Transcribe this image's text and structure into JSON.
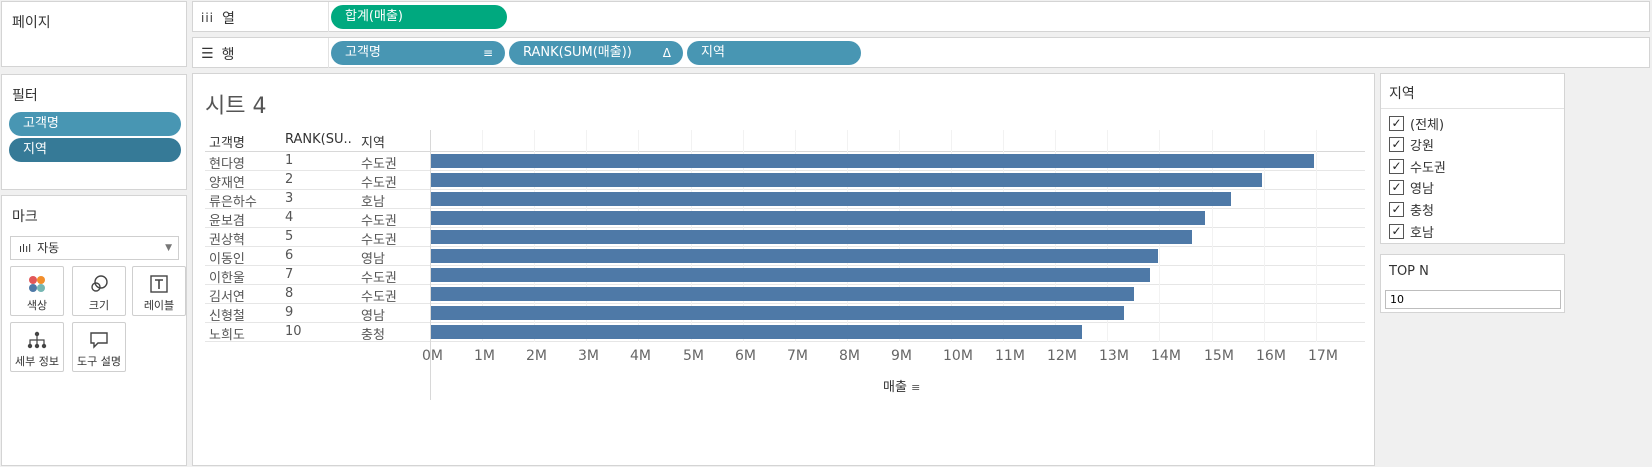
{
  "shelves": {
    "pages_label": "페이지",
    "columns_label": "열",
    "rows_label": "행",
    "columns_pill": "합계(매출)",
    "rows_pills": [
      "고객명",
      "RANK(SUM(매출))",
      "지역"
    ]
  },
  "filters": {
    "title": "필터",
    "items": [
      "고객명",
      "지역"
    ]
  },
  "marks": {
    "title": "마크",
    "type_value": "자동",
    "buttons": [
      "색상",
      "크기",
      "레이블",
      "세부 정보",
      "도구 설명"
    ]
  },
  "sheet": {
    "title": "시트 4",
    "headers": [
      "고객명",
      "RANK(SU..",
      "지역"
    ],
    "rows": [
      {
        "name": "현다영",
        "rank": "1",
        "region": "수도권"
      },
      {
        "name": "양재연",
        "rank": "2",
        "region": "수도권"
      },
      {
        "name": "류은하수",
        "rank": "3",
        "region": "호남"
      },
      {
        "name": "윤보겸",
        "rank": "4",
        "region": "수도권"
      },
      {
        "name": "권상혁",
        "rank": "5",
        "region": "수도권"
      },
      {
        "name": "이동인",
        "rank": "6",
        "region": "영남"
      },
      {
        "name": "이한울",
        "rank": "7",
        "region": "수도권"
      },
      {
        "name": "김서연",
        "rank": "8",
        "region": "수도권"
      },
      {
        "name": "신형철",
        "rank": "9",
        "region": "영남"
      },
      {
        "name": "노희도",
        "rank": "10",
        "region": "충청"
      }
    ],
    "axis_label": "매출"
  },
  "chart_data": {
    "type": "bar",
    "orientation": "horizontal",
    "categories": [
      "현다영",
      "양재연",
      "류은하수",
      "윤보겸",
      "권상혁",
      "이동인",
      "이한울",
      "김서연",
      "신형철",
      "노희도"
    ],
    "values": [
      16.95,
      15.95,
      15.35,
      14.85,
      14.6,
      13.95,
      13.8,
      13.5,
      13.3,
      12.5
    ],
    "value_unit": "M",
    "xlabel": "매출",
    "xlim": [
      0,
      17.9
    ],
    "ticks": [
      "0M",
      "1M",
      "2M",
      "3M",
      "4M",
      "5M",
      "6M",
      "7M",
      "8M",
      "9M",
      "10M",
      "11M",
      "12M",
      "13M",
      "14M",
      "15M",
      "16M",
      "17M"
    ],
    "bar_color": "#4e79a7",
    "grid": true
  },
  "region_filter": {
    "title": "지역",
    "options": [
      {
        "label": "(전체)",
        "checked": true
      },
      {
        "label": "강원",
        "checked": true
      },
      {
        "label": "수도권",
        "checked": true
      },
      {
        "label": "영남",
        "checked": true
      },
      {
        "label": "충청",
        "checked": true
      },
      {
        "label": "호남",
        "checked": true
      }
    ]
  },
  "topn": {
    "title": "TOP N",
    "value": "10"
  }
}
